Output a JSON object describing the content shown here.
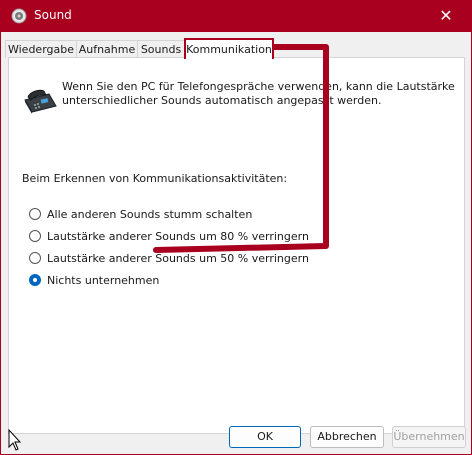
{
  "window": {
    "title": "Sound",
    "close_glyph": "✕",
    "title_icon": "speaker-icon",
    "accent_color": "#a8001e"
  },
  "tabs": [
    {
      "label": "Wiedergabe"
    },
    {
      "label": "Aufnahme"
    },
    {
      "label": "Sounds"
    },
    {
      "label": "Kommunikation",
      "active": true
    }
  ],
  "panel": {
    "icon": "telephone-icon",
    "description": "Wenn Sie den PC für Telefongespräche verwenden, kann die Lautstärke unterschiedlicher Sounds automatisch angepasst werden.",
    "heading": "Beim Erkennen von Kommunikationsaktivitäten:",
    "options": [
      {
        "label": "Alle anderen Sounds stumm schalten",
        "checked": false
      },
      {
        "label": "Lautstärke anderer Sounds um 80 % verringern",
        "checked": false
      },
      {
        "label": "Lautstärke anderer Sounds um 50 % verringern",
        "checked": false
      },
      {
        "label": "Nichts unternehmen",
        "checked": true
      }
    ]
  },
  "buttons": {
    "ok": "OK",
    "cancel": "Abbrechen",
    "apply": "Übernehmen"
  },
  "annotation_color": "#a8001e"
}
